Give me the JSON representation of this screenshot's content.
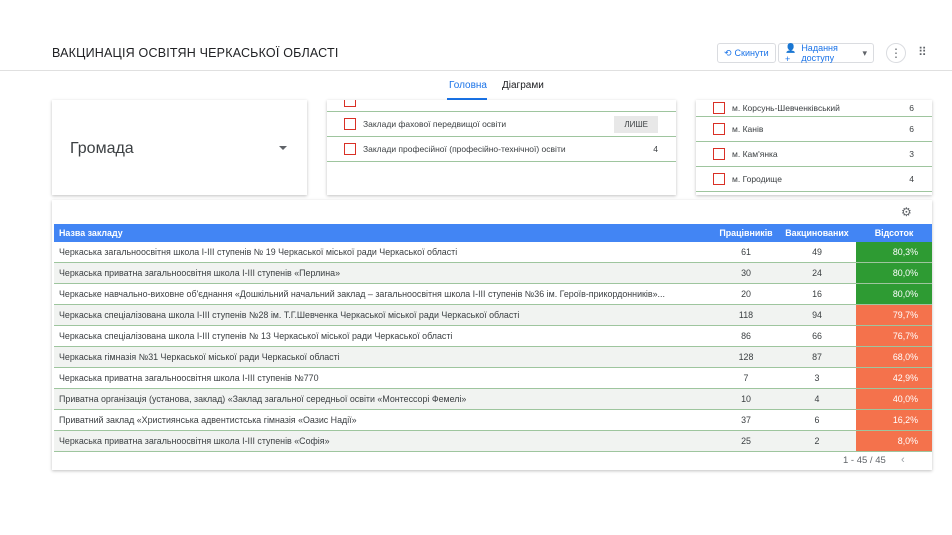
{
  "header": {
    "title": "ВАКЦИНАЦІЯ ОСВІТЯН ЧЕРКАСЬКОЇ ОБЛАСТІ",
    "reset_label": "Скинути",
    "share_label": "Надання доступу"
  },
  "tabs": [
    {
      "label": "Головна",
      "active": true
    },
    {
      "label": "Діаграми",
      "active": false
    }
  ],
  "hromada": {
    "label": "Громада"
  },
  "type_filter": {
    "items": [
      {
        "label": "Заклади фахової передвищої освіти",
        "count": "ЛИШЕ"
      },
      {
        "label": "Заклади професійної (професійно-технічної) освіти",
        "count": "4"
      }
    ]
  },
  "city_filter": {
    "items": [
      {
        "label": "м. Корсунь-Шевченківський",
        "count": "6"
      },
      {
        "label": "м. Канів",
        "count": "6"
      },
      {
        "label": "м. Кам'янка",
        "count": "3"
      },
      {
        "label": "м. Городище",
        "count": "4"
      }
    ]
  },
  "table": {
    "headers": {
      "name": "Назва закладу",
      "workers": "Працівників",
      "vaccinated": "Вакцинованих",
      "percent": "Відсоток"
    },
    "rows": [
      {
        "name": "Черкаська загальноосвітня школа І-ІІІ ступенів № 19 Черкаської міської ради Черкаської області",
        "workers": "61",
        "vaccinated": "49",
        "percent": "80,3%"
      },
      {
        "name": "Черкаська приватна загальноосвітня школа І-ІІІ ступенів «Перлина»",
        "workers": "30",
        "vaccinated": "24",
        "percent": "80,0%"
      },
      {
        "name": "Черкаське навчально-виховне об'єднання «Дошкільний начальний заклад – загальноосвітня школа І-ІІІ ступенів №36 ім. Героїв-прикордонників»...",
        "workers": "20",
        "vaccinated": "16",
        "percent": "80,0%"
      },
      {
        "name": "Черкаська спеціалізована школа І-ІІІ ступенів №28 ім. Т.Г.Шевченка Черкаської міської ради Черкаської області",
        "workers": "118",
        "vaccinated": "94",
        "percent": "79,7%"
      },
      {
        "name": "Черкаська спеціалізована школа І-ІІІ ступенів № 13 Черкаської міської ради Черкаської області",
        "workers": "86",
        "vaccinated": "66",
        "percent": "76,7%"
      },
      {
        "name": "Черкаська гімназія №31 Черкаської міської ради Черкаської області",
        "workers": "128",
        "vaccinated": "87",
        "percent": "68,0%"
      },
      {
        "name": "Черкаська приватна загальноосвітня школа І-ІІІ ступенів №770",
        "workers": "7",
        "vaccinated": "3",
        "percent": "42,9%"
      },
      {
        "name": "Приватна організація (установа, заклад) «Заклад загальної середньої освіти «Монтессорі Фемелі»",
        "workers": "10",
        "vaccinated": "4",
        "percent": "40,0%"
      },
      {
        "name": "Приватний заклад «Християнська адвентистська гімназія «Оазис Надії»",
        "workers": "37",
        "vaccinated": "6",
        "percent": "16,2%"
      },
      {
        "name": "Черкаська приватна загальноосвітня школа І-ІІІ ступенів «Софія»",
        "workers": "25",
        "vaccinated": "2",
        "percent": "8,0%"
      }
    ]
  },
  "pagination": {
    "text": "1 - 45 / 45"
  },
  "colors": {
    "accent": "#1a73e8",
    "header_bg": "#4285f4",
    "high": "#2e9b33",
    "low": "#f4724c"
  }
}
